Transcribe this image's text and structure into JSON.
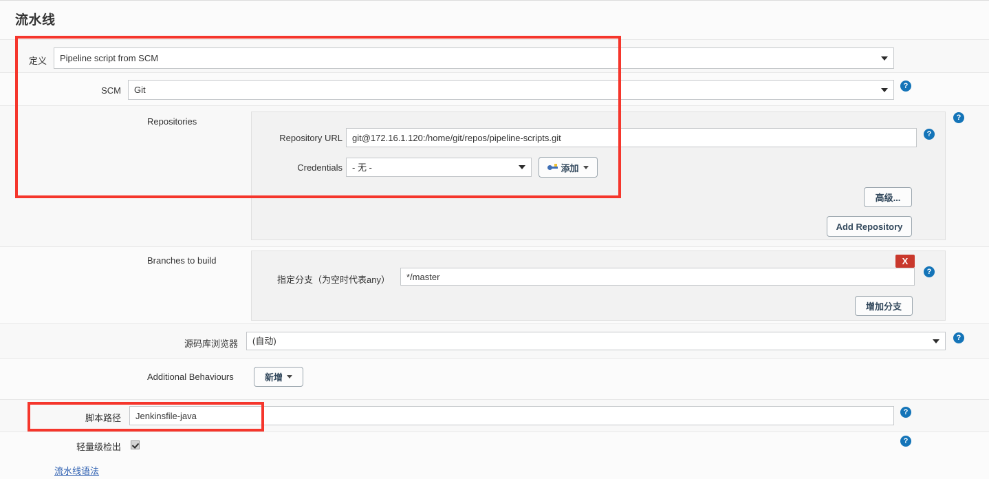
{
  "page": {
    "title": "流水线"
  },
  "definition": {
    "label": "定义",
    "value": "Pipeline script from SCM"
  },
  "scm": {
    "label": "SCM",
    "value": "Git",
    "help": "?"
  },
  "repositories": {
    "label": "Repositories",
    "help": "?",
    "repository_url": {
      "label": "Repository URL",
      "value": "git@172.16.1.120:/home/git/repos/pipeline-scripts.git",
      "help": "?"
    },
    "credentials": {
      "label": "Credentials",
      "value": "- 无 -",
      "add_button": "添加",
      "add_icon": "key-icon"
    },
    "advanced_button": "高级...",
    "add_repository_button": "Add Repository"
  },
  "branches": {
    "label": "Branches to build",
    "help": "?",
    "specifier": {
      "label": "指定分支（为空时代表any）",
      "value": "*/master"
    },
    "delete_button": "X",
    "add_branch_button": "增加分支"
  },
  "repository_browser": {
    "label": "源码库浏览器",
    "value": "(自动)",
    "help": "?"
  },
  "additional_behaviours": {
    "label": "Additional Behaviours",
    "add_button": "新增"
  },
  "script_path": {
    "label": "脚本路径",
    "value": "Jenkinsfile-java",
    "help": "?"
  },
  "lightweight_checkout": {
    "label": "轻量级检出",
    "checked": true,
    "help": "?"
  },
  "pipeline_syntax_link": "流水线语法",
  "colors": {
    "annotation": "#f5362c",
    "help_blue": "#1474b8",
    "link_blue": "#2a5db0",
    "delete_red": "#c9382c"
  }
}
